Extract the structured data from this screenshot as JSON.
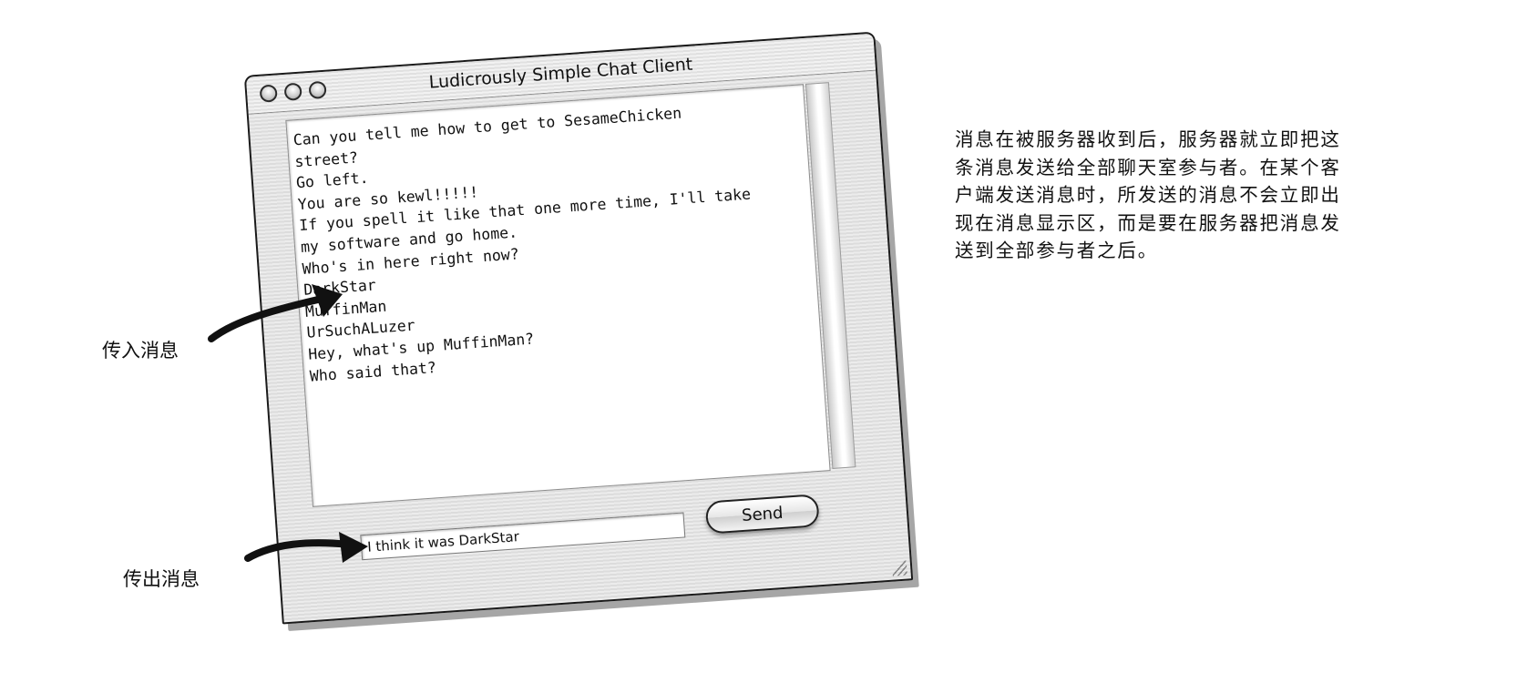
{
  "window": {
    "title": "Ludicrously Simple Chat Client",
    "message_lines": [
      "Can you tell me how to get to SesameChicken",
      "street?",
      "Go left.",
      "You are so kewl!!!!!",
      "If you spell it like that one more time, I'll take",
      "my software and go home.",
      "Who's in here right now?",
      "DarkStar",
      "MuffinMan",
      "UrSuchALuzer",
      "Hey, what's up MuffinMan?",
      "Who said that?"
    ],
    "input_value": "I think it was DarkStar",
    "send_label": "Send"
  },
  "callouts": {
    "incoming": "传入消息",
    "outgoing": "传出消息"
  },
  "description": "消息在被服务器收到后，服务器就立即把这条消息发送给全部聊天室参与者。在某个客户端发送消息时，所发送的消息不会立即出现在消息显示区，而是要在服务器把消息发送到全部参与者之后。",
  "icons": {
    "window_controls": [
      "close-icon",
      "minimize-icon",
      "zoom-icon"
    ],
    "callout_arrows": [
      "incoming-arrow-icon",
      "outgoing-arrow-icon"
    ],
    "resize": "resize-grip-icon"
  },
  "colors": {
    "ink": "#111111",
    "window_stripe_light": "#ececec",
    "window_stripe_dark": "#dcdcdc"
  }
}
